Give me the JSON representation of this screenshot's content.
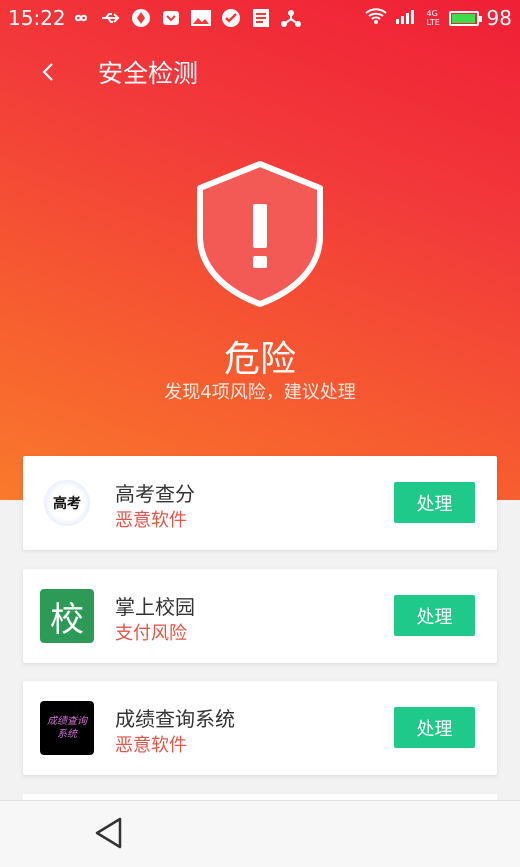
{
  "status_bar": {
    "time": "15:22",
    "icons": [
      "infinity-icon",
      "usb-icon",
      "vpn-icon",
      "pocket-icon",
      "image-icon",
      "check-icon",
      "news-icon",
      "share-node-icon"
    ],
    "network": "4G LTE",
    "battery": "98",
    "battery_level": 0.98
  },
  "appbar": {
    "title": "安全检测"
  },
  "result": {
    "level": "危险",
    "summary": "发现4项风险，建议处理"
  },
  "colors": {
    "danger_gradient_start": "#f01f36",
    "danger_gradient_end": "#f97a2c",
    "action_green": "#1ec98a",
    "risk_red": "#e0564a"
  },
  "risks": [
    {
      "name": "高考查分",
      "type": "恶意软件",
      "action": "处理",
      "icon": "gaokao-app-icon",
      "icon_text": "高考"
    },
    {
      "name": "掌上校园",
      "type": "支付风险",
      "action": "处理",
      "icon": "campus-app-icon",
      "icon_text": "校"
    },
    {
      "name": "成绩查询系统",
      "type": "恶意软件",
      "action": "处理",
      "icon": "grade-query-app-icon",
      "icon_text": "成绩查询系统"
    }
  ]
}
